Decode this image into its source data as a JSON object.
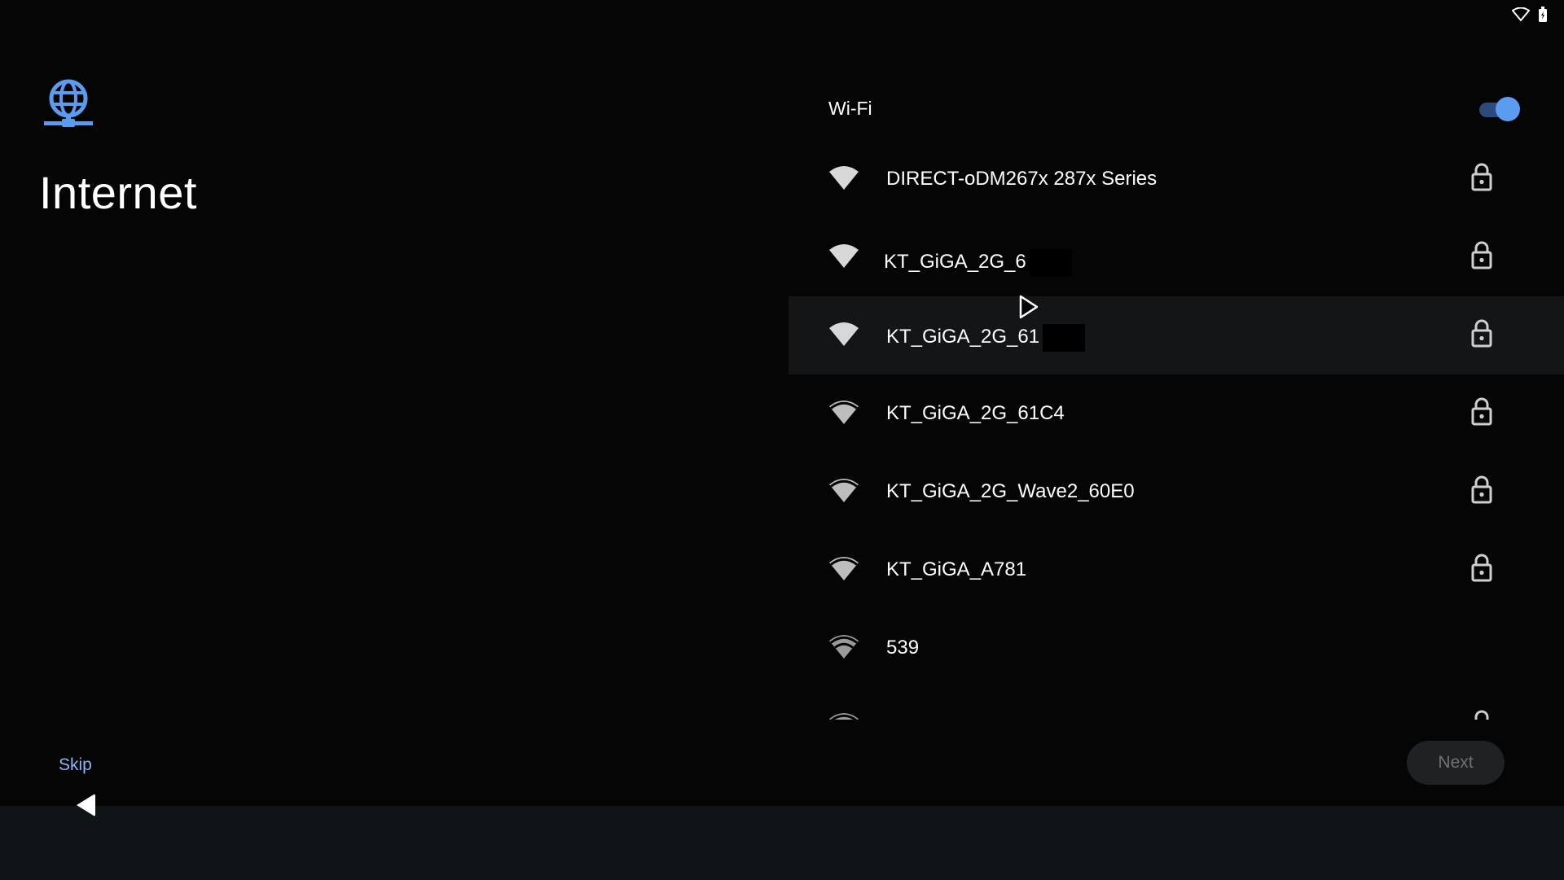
{
  "status_bar": {
    "icons": [
      "wifi-icon",
      "battery-icon"
    ]
  },
  "header": {
    "icon": "globe-network-icon",
    "title": "Internet"
  },
  "wifi": {
    "label": "Wi-Fi",
    "enabled": true,
    "accent_color": "#5b9bf0",
    "networks": [
      {
        "ssid": "DIRECT-oDM267x 287x Series",
        "secured": true,
        "redacted": false
      },
      {
        "ssid": "KT_GiGA_2G_6",
        "secured": true,
        "redacted": true
      },
      {
        "ssid": "KT_GiGA_2G_61",
        "secured": true,
        "redacted": true,
        "focused": true
      },
      {
        "ssid": "KT_GiGA_2G_61C4",
        "secured": true,
        "redacted": false
      },
      {
        "ssid": "KT_GiGA_2G_Wave2_60E0",
        "secured": true,
        "redacted": false
      },
      {
        "ssid": "KT_GiGA_A781",
        "secured": true,
        "redacted": false
      },
      {
        "ssid": "539",
        "secured": false,
        "redacted": false
      },
      {
        "ssid": "",
        "secured": true,
        "redacted": false
      }
    ]
  },
  "footer": {
    "skip_label": "Skip",
    "next_label": "Next",
    "next_enabled": false
  },
  "nav": {
    "back_icon": "back-triangle-icon"
  }
}
